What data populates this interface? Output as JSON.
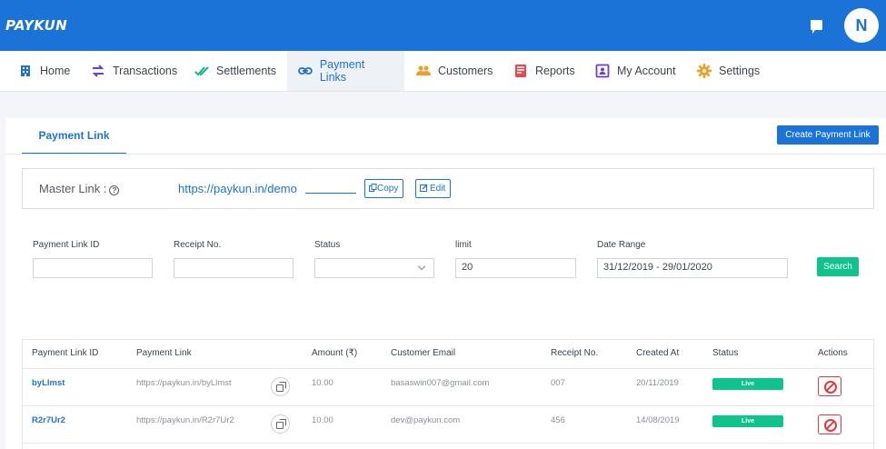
{
  "brand": {
    "logo_text": "PAYKUN"
  },
  "header": {
    "avatar_initial": "N"
  },
  "nav": [
    {
      "key": "home",
      "label": "Home",
      "icon": "building-icon"
    },
    {
      "key": "transactions",
      "label": "Transactions",
      "icon": "swap-arrows-icon"
    },
    {
      "key": "settlements",
      "label": "Settlements",
      "icon": "double-check-icon"
    },
    {
      "key": "payment-links",
      "label": "Payment Links",
      "icon": "link-icon",
      "active": true
    },
    {
      "key": "customers",
      "label": "Customers",
      "icon": "users-icon"
    },
    {
      "key": "reports",
      "label": "Reports",
      "icon": "report-icon"
    },
    {
      "key": "my-account",
      "label": "My Account",
      "icon": "id-card-icon"
    },
    {
      "key": "settings",
      "label": "Settings",
      "icon": "gear-icon"
    }
  ],
  "page": {
    "tab_label": "Payment Link",
    "create_button": "Create Payment Link"
  },
  "master": {
    "label": "Master Link :",
    "help_glyph": "?",
    "url": "https://paykun.in/demo",
    "copy_label": "Copy",
    "edit_label": "Edit"
  },
  "filters": {
    "payment_link_id": {
      "label": "Payment Link ID",
      "value": ""
    },
    "receipt_no": {
      "label": "Receipt No.",
      "value": ""
    },
    "status": {
      "label": "Status",
      "value": ""
    },
    "limit": {
      "label": "limit",
      "value": "20"
    },
    "date_range": {
      "label": "Date Range",
      "value": "31/12/2019 - 29/01/2020"
    },
    "search_button": "Search"
  },
  "table": {
    "columns": [
      "Payment Link ID",
      "Payment Link",
      "Amount (₹)",
      "Customer Email",
      "Receipt No.",
      "Created At",
      "Status",
      "Actions"
    ],
    "rows": [
      {
        "id": "byLlmst",
        "link": "https://paykun.in/byLlmst",
        "amount": "10.00",
        "email": "basaswin007@gmail.com",
        "receipt": "007",
        "created": "20/11/2019",
        "status": "Live"
      },
      {
        "id": "R2r7Ur2",
        "link": "https://paykun.in/R2r7Ur2",
        "amount": "10.00",
        "email": "dev@paykun.com",
        "receipt": "456",
        "created": "14/08/2019",
        "status": "Live"
      }
    ]
  },
  "colors": {
    "primary": "#1b73d8",
    "success": "#0fc48c",
    "danger": "#e23b3b"
  }
}
